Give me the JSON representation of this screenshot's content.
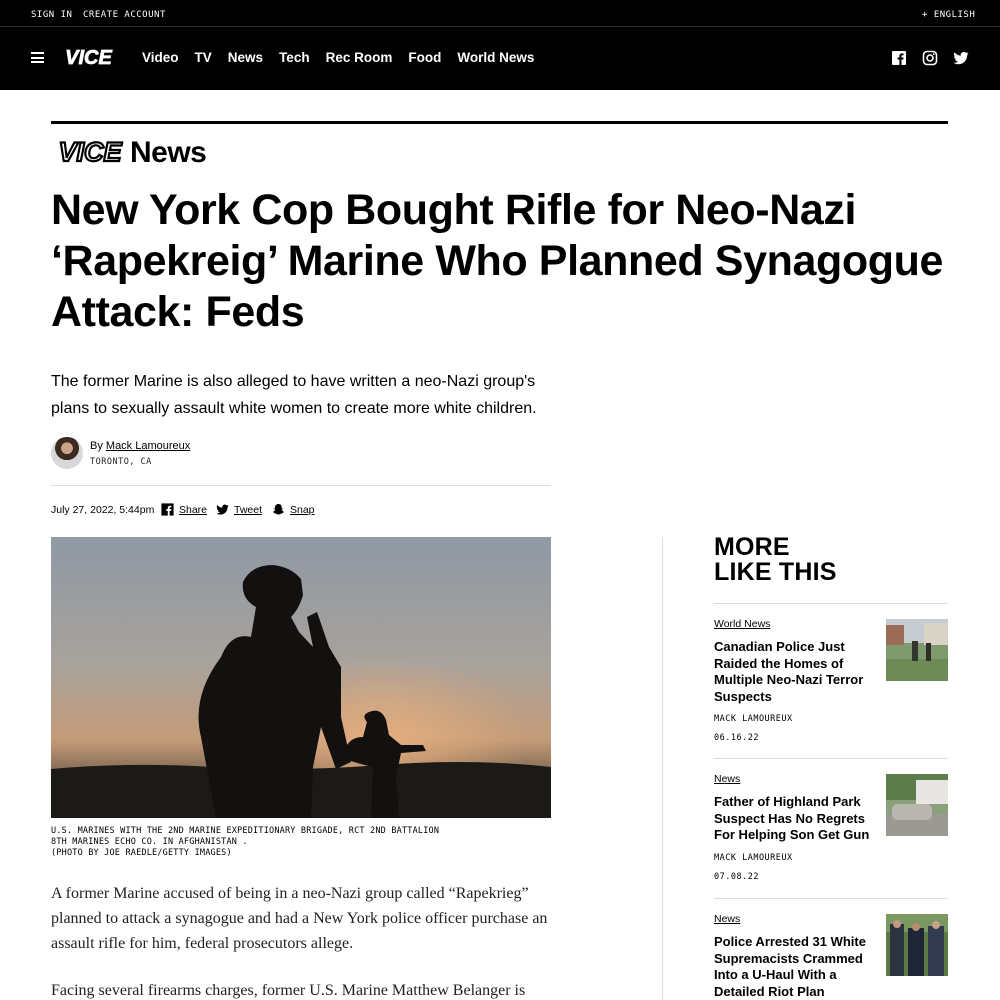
{
  "utility": {
    "sign_in": "SIGN IN",
    "create_account": "CREATE ACCOUNT",
    "language": "+ ENGLISH"
  },
  "nav": {
    "logo_text": "VICE",
    "links": [
      "Video",
      "TV",
      "News",
      "Tech",
      "Rec Room",
      "Food",
      "World News"
    ]
  },
  "article": {
    "brand_logo_text": "VICE",
    "brand_word": "News",
    "headline": "New York Cop Bought Rifle for Neo-Nazi ‘Rapekreig’ Marine Who Planned Synagogue Attack: Feds",
    "dek": "The former Marine is also alleged to have written a neo-Nazi group's plans to sexually assault white women to create more white children.",
    "by_prefix": "By",
    "author": "Mack Lamoureux",
    "location": "TORONTO, CA",
    "date": "July 27, 2022, 5:44pm",
    "share": {
      "facebook": "Share",
      "twitter": "Tweet",
      "snapchat": "Snap"
    },
    "caption": "U.S. MARINES WITH THE 2ND MARINE EXPEDITIONARY BRIGADE, RCT 2ND BATTALION\n8TH MARINES ECHO CO. IN AFGHANISTAN .\n (PHOTO BY JOE RAEDLE/GETTY IMAGES)",
    "paragraphs": [
      "A former Marine accused of being in a neo-Nazi group called “Rapekrieg” planned to attack a synagogue and had a New York police officer purchase an assault rifle for him, federal prosecutors allege.",
      "Facing several firearms charges, former U.S. Marine Matthew Belanger is"
    ]
  },
  "sidebar": {
    "title_line1": "MORE",
    "title_line2": "LIKE THIS",
    "items": [
      {
        "category": "World News",
        "title": "Canadian Police Just Raided the Homes of Multiple Neo-Nazi Terror Suspects",
        "author": "MACK LAMOUREUX",
        "date": "06.16.22"
      },
      {
        "category": "News",
        "title": "Father of Highland Park Suspect Has No Regrets For Helping Son Get Gun",
        "author": "MACK LAMOUREUX",
        "date": "07.08.22"
      },
      {
        "category": "News",
        "title": "Police Arrested 31 White Supremacists Crammed Into a U-Haul With a Detailed Riot Plan",
        "author": "",
        "date": ""
      }
    ]
  },
  "colors": {
    "nav_bg": "#000000",
    "text": "#000000",
    "rule": "#dddddd"
  }
}
